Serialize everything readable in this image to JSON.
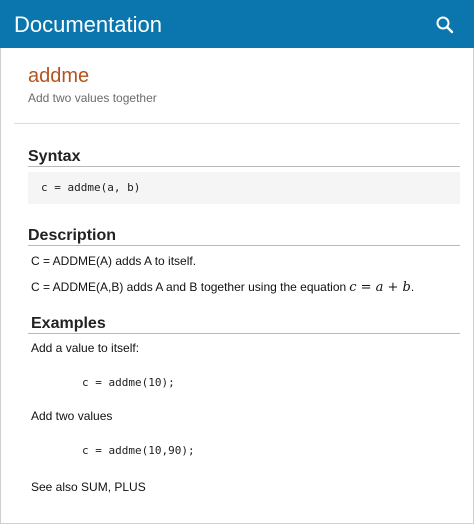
{
  "header": {
    "title": "Documentation",
    "search_icon": "search-icon"
  },
  "page": {
    "title": "addme",
    "subtitle": "Add two values together"
  },
  "syntax": {
    "heading": "Syntax",
    "code": "c = addme(a, b)"
  },
  "description": {
    "heading": "Description",
    "line1": "C = ADDME(A) adds A to itself.",
    "line2": "C = ADDME(A,B) adds A and B together using the equation",
    "equation": "c = a + b",
    "line2_end": "."
  },
  "examples": {
    "heading": "Examples",
    "intro1": "Add a value to itself:",
    "code1": "c = addme(10);",
    "intro2": "Add two values",
    "code2": "c = addme(10,90);",
    "see_also": "See also SUM, PLUS"
  },
  "colors": {
    "header_bg": "#0a76ad",
    "title": "#b7521c"
  }
}
